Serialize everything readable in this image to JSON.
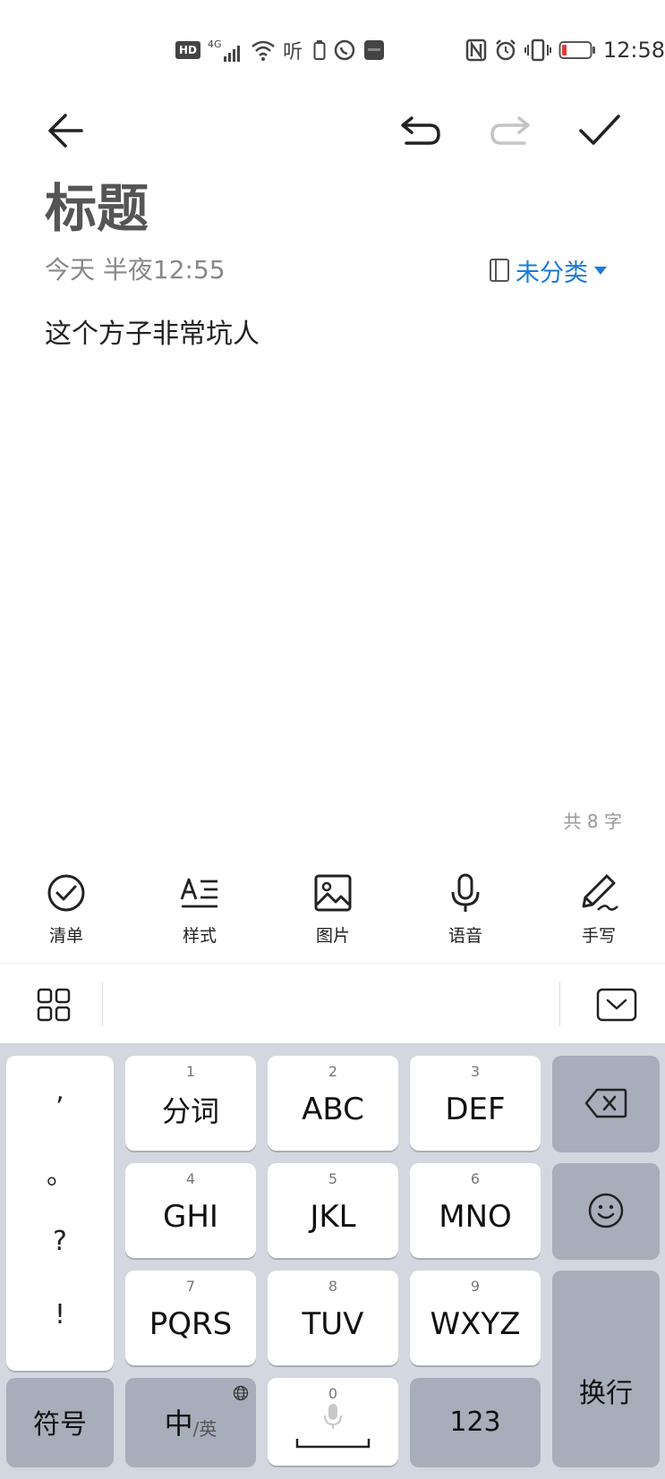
{
  "status_bar": {
    "hd": "HD",
    "network": "4G",
    "time": "12:58"
  },
  "note": {
    "title": "标题",
    "date": "今天 半夜12:55",
    "category": "未分类",
    "body": "这个方子非常坑人",
    "char_count": "共 8 字"
  },
  "tools": {
    "checklist": "清单",
    "style": "样式",
    "image": "图片",
    "voice": "语音",
    "handwrite": "手写"
  },
  "keyboard": {
    "punct": [
      ",",
      "。",
      "?",
      "!"
    ],
    "keys": [
      {
        "num": "1",
        "label": "分词"
      },
      {
        "num": "2",
        "label": "ABC"
      },
      {
        "num": "3",
        "label": "DEF"
      },
      {
        "num": "4",
        "label": "GHI"
      },
      {
        "num": "5",
        "label": "JKL"
      },
      {
        "num": "6",
        "label": "MNO"
      },
      {
        "num": "7",
        "label": "PQRS"
      },
      {
        "num": "8",
        "label": "TUV"
      },
      {
        "num": "9",
        "label": "WXYZ"
      }
    ],
    "symbols": "符号",
    "lang_main": "中",
    "lang_sub": "/英",
    "space_num": "0",
    "num_key": "123",
    "enter": "换行"
  },
  "colors": {
    "accent": "#1a7bd9",
    "keyboard_bg": "#d3d7df",
    "key_dark": "#a7adba",
    "battery_low": "#e53935"
  }
}
